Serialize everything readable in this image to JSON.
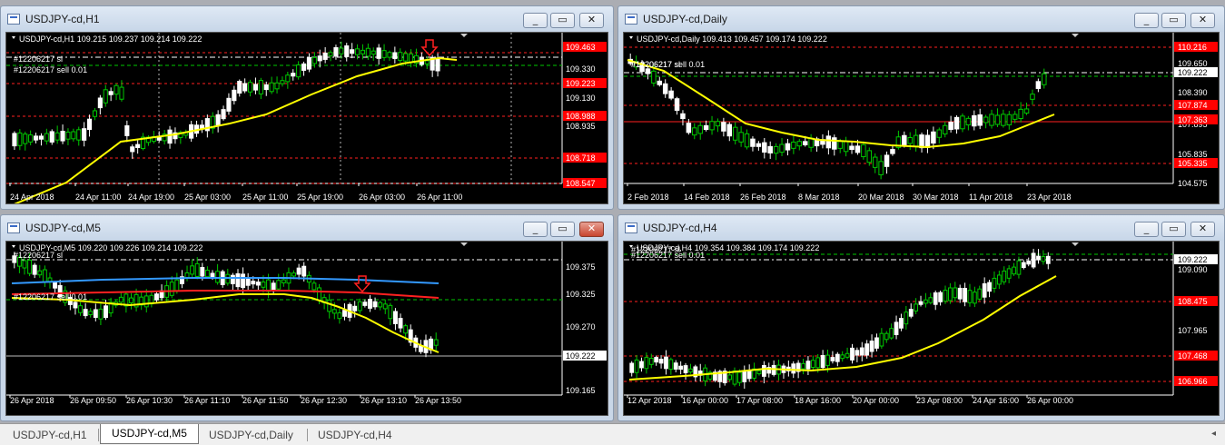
{
  "windows": [
    {
      "id": "h1",
      "title": "USDJPY-cd,H1",
      "header": "USDJPY-cd,H1  109.215 109.237 109.214 109.222",
      "orders": [
        "#12206217 sl",
        "#12206217 sell 0.01"
      ],
      "active_close": false,
      "price_axis": [
        "109.330",
        "109.130",
        "108.935"
      ],
      "price_boxes": [
        {
          "text": "109.463",
          "kind": "red"
        },
        {
          "text": "109.223",
          "kind": "red"
        },
        {
          "text": "108.988",
          "kind": "red"
        },
        {
          "text": "108.718",
          "kind": "red"
        },
        {
          "text": "108.547",
          "kind": "red"
        }
      ],
      "time_axis": [
        "24 Apr 2018",
        "24 Apr 11:00",
        "24 Apr 19:00",
        "25 Apr 03:00",
        "25 Apr 11:00",
        "25 Apr 19:00",
        "26 Apr 03:00",
        "26 Apr 11:00"
      ]
    },
    {
      "id": "daily",
      "title": "USDJPY-cd,Daily",
      "header": "USDJPY-cd,Daily  109.413 109.457 109.174 109.222",
      "orders": [
        "#12206217 sl",
        "#12206217 sell 0.01"
      ],
      "active_close": false,
      "price_axis": [
        "109.650",
        "108.390",
        "107.895",
        "105.835",
        "104.575"
      ],
      "price_boxes": [
        {
          "text": "110.216",
          "kind": "red"
        },
        {
          "text": "109.222",
          "kind": "white"
        },
        {
          "text": "107.874",
          "kind": "red"
        },
        {
          "text": "107.363",
          "kind": "red"
        },
        {
          "text": "105.335",
          "kind": "red"
        }
      ],
      "time_axis": [
        "2 Feb 2018",
        "14 Feb 2018",
        "26 Feb 2018",
        "8 Mar 2018",
        "20 Mar 2018",
        "30 Mar 2018",
        "11 Apr 2018",
        "23 Apr 2018"
      ]
    },
    {
      "id": "m5",
      "title": "USDJPY-cd,M5",
      "header": "USDJPY-cd,M5  109.220 109.226 109.214 109.222",
      "orders": [
        "#12206217 sl",
        "#12206217 sell 0.01"
      ],
      "active_close": true,
      "price_axis": [
        "109.375",
        "109.325",
        "109.270",
        "109.165"
      ],
      "price_boxes": [
        {
          "text": "109.222",
          "kind": "white"
        }
      ],
      "time_axis": [
        "26 Apr 2018",
        "26 Apr 09:50",
        "26 Apr 10:30",
        "26 Apr 11:10",
        "26 Apr 11:50",
        "26 Apr 12:30",
        "26 Apr 13:10",
        "26 Apr 13:50"
      ]
    },
    {
      "id": "h4",
      "title": "USDJPY-cd,H4",
      "header": "USDJPY-cd,H4  109.354 109.384 109.174 109.222",
      "orders": [
        "#12206217 sl",
        "#12206217 sell 0.01"
      ],
      "active_close": false,
      "price_axis": [
        "109.090",
        "107.965"
      ],
      "price_boxes": [
        {
          "text": "109.222",
          "kind": "white"
        },
        {
          "text": "108.475",
          "kind": "red"
        },
        {
          "text": "107.468",
          "kind": "red"
        },
        {
          "text": "106.966",
          "kind": "red"
        }
      ],
      "time_axis": [
        "12 Apr 2018",
        "16 Apr 00:00",
        "17 Apr 08:00",
        "18 Apr 16:00",
        "20 Apr 00:00",
        "23 Apr 08:00",
        "24 Apr 16:00",
        "26 Apr 00:00"
      ]
    }
  ],
  "tabs": [
    "USDJPY-cd,H1",
    "USDJPY-cd,M5",
    "USDJPY-cd,Daily",
    "USDJPY-cd,H4"
  ],
  "active_tab": 1,
  "window_buttons": {
    "minimize": "_",
    "maximize": "▭",
    "close": "✕"
  },
  "tab_scroll_arrow": "◂",
  "colors": {
    "background": "#000000",
    "up_candle": "#ffffff",
    "down_candle": "#00c800",
    "moving_average": "#ffff00",
    "ma_blue": "#3399ff",
    "ma_red": "#ff2020",
    "level_red": "#ff0000",
    "order_line": "#00b400",
    "grid": "#ffffff"
  }
}
